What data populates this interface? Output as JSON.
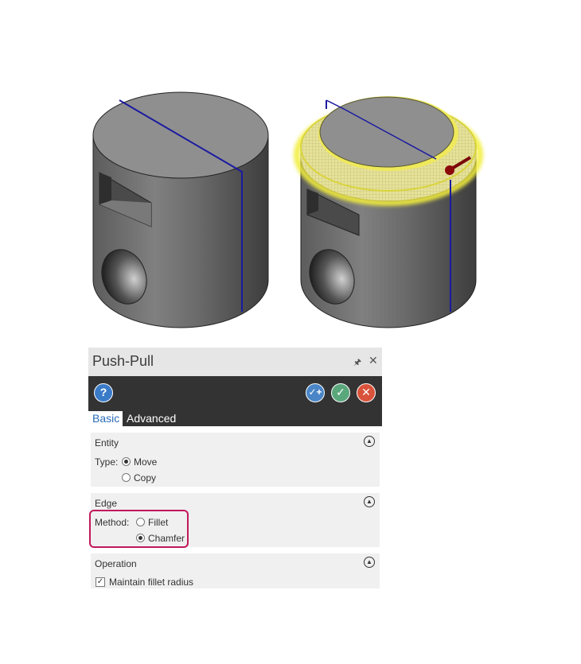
{
  "panel": {
    "title": "Push-Pull",
    "pin_icon": "pin-icon",
    "close_icon": "close-icon",
    "toolbar": {
      "help_glyph": "?",
      "apply_new_glyph": "✓+",
      "ok_glyph": "✓",
      "cancel_glyph": "✕"
    },
    "tabs": [
      {
        "label": "Basic",
        "active": true
      },
      {
        "label": "Advanced",
        "active": false
      }
    ],
    "entity": {
      "title": "Entity",
      "type_label": "Type:",
      "options": [
        {
          "label": "Move",
          "selected": true
        },
        {
          "label": "Copy",
          "selected": false
        }
      ]
    },
    "edge": {
      "title": "Edge",
      "method_label": "Method:",
      "options": [
        {
          "label": "Fillet",
          "selected": false
        },
        {
          "label": "Chamfer",
          "selected": true
        }
      ]
    },
    "operation": {
      "title": "Operation",
      "maintain_label": "Maintain fillet radius",
      "maintain_checked": true
    }
  },
  "colors": {
    "accent_tab": "#2b6cb8",
    "highlight_border": "#c2185b",
    "selection_yellow": "#e8e84a",
    "edge_blue": "#1a1aa0"
  }
}
